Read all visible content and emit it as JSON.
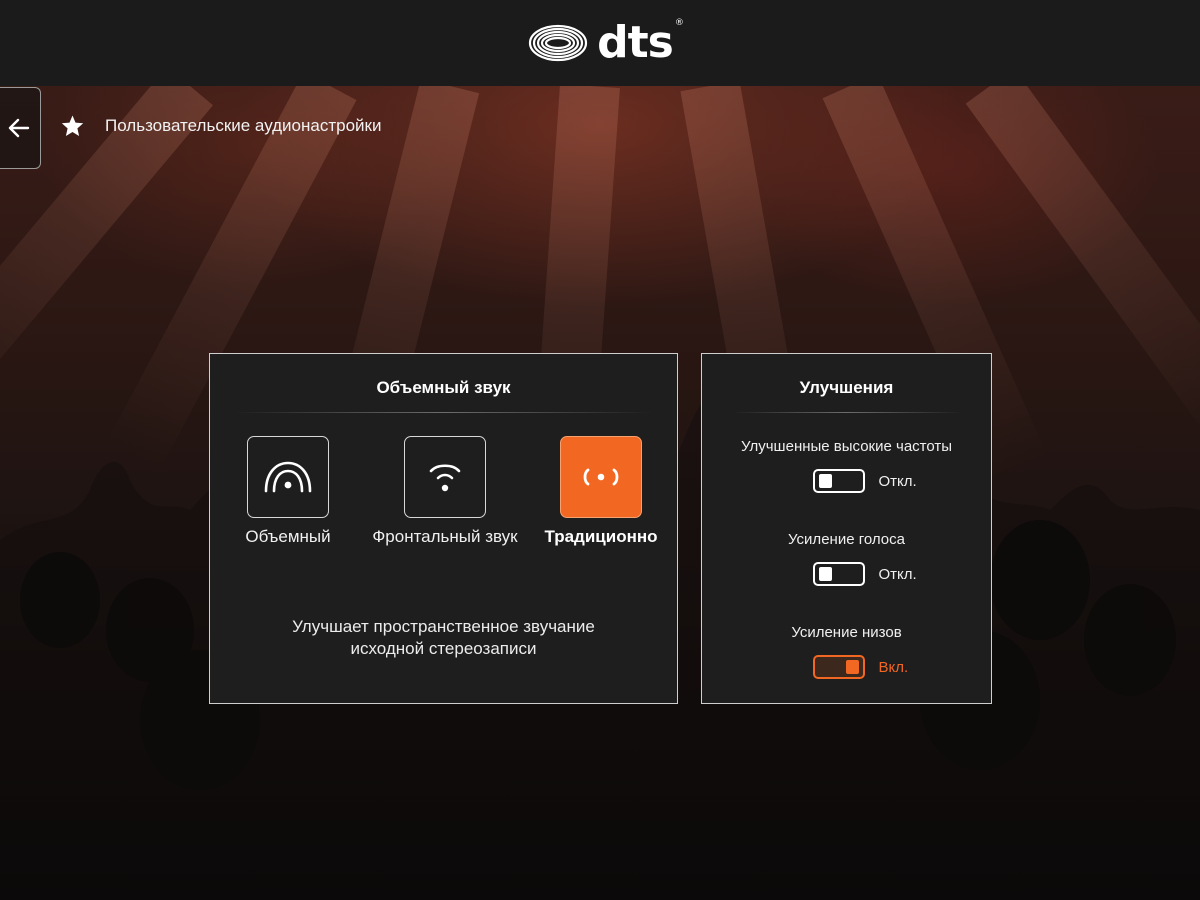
{
  "header": {
    "logo_text": "dts",
    "logo_reg": "®"
  },
  "nav": {
    "back_icon": "arrow-left-icon",
    "title_icon": "star-icon",
    "title": "Пользовательские аудионастройки"
  },
  "surround": {
    "title": "Объемный звук",
    "modes": [
      {
        "label": "Объемный",
        "icon": "surround-arc-icon",
        "selected": false
      },
      {
        "label": "Фронтальный звук",
        "icon": "front-wave-icon",
        "selected": false
      },
      {
        "label": "Традиционно",
        "icon": "stereo-icon",
        "selected": true
      }
    ],
    "description_line1": "Улучшает пространственное звучание",
    "description_line2": "исходной стереозаписи"
  },
  "enhancements": {
    "title": "Улучшения",
    "items": [
      {
        "label": "Улучшенные высокие частоты",
        "state": "Откл.",
        "on": false
      },
      {
        "label": "Усиление голоса",
        "state": "Откл.",
        "on": false
      },
      {
        "label": "Усиление низов",
        "state": "Вкл.",
        "on": true
      }
    ]
  },
  "colors": {
    "accent": "#f26722",
    "panel_bg": "#1e1e1e",
    "topbar_bg": "#1b1b1b"
  }
}
